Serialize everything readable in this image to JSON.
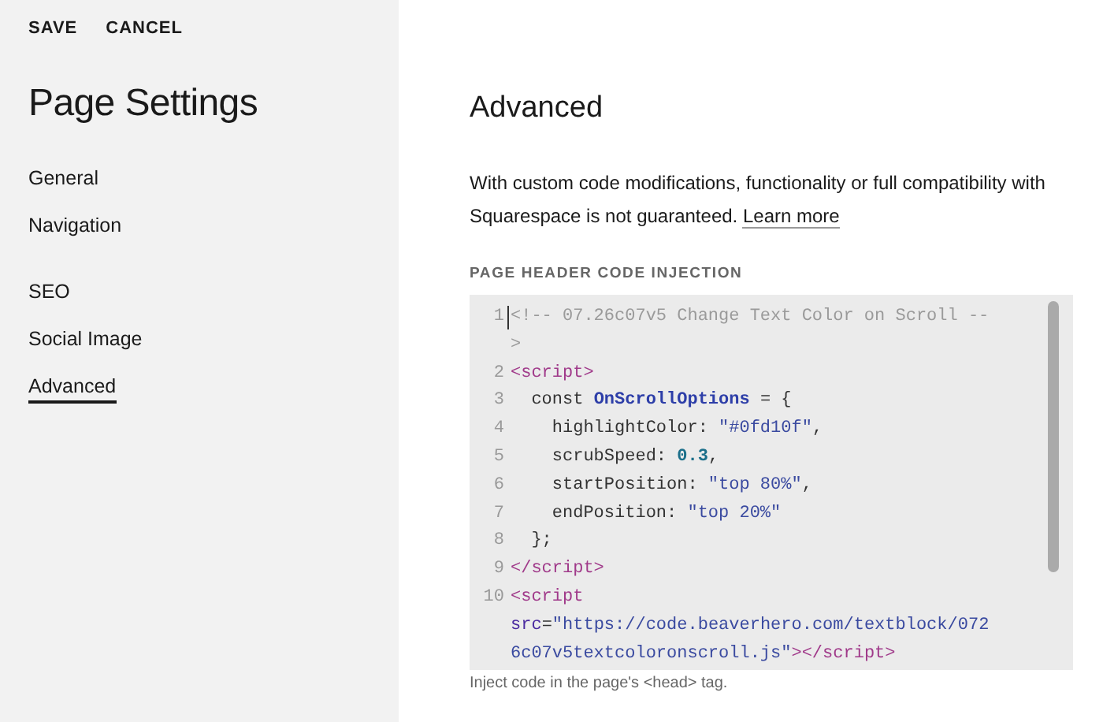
{
  "top_actions": [
    "SAVE",
    "CANCEL"
  ],
  "sidebar": {
    "title": "Page Settings",
    "groups": [
      [
        {
          "label": "General",
          "selected": false
        },
        {
          "label": "Navigation",
          "selected": false
        }
      ],
      [
        {
          "label": "SEO",
          "selected": false
        },
        {
          "label": "Social Image",
          "selected": false
        },
        {
          "label": "Advanced",
          "selected": true
        }
      ]
    ]
  },
  "main": {
    "heading": "Advanced",
    "notice": "With custom code modifications, functionality or full compatibility with Squarespace is not guaranteed.",
    "notice_link": "Learn more",
    "section_label": "PAGE HEADER CODE INJECTION",
    "code_lines": [
      {
        "number": "1",
        "rows": [
          {
            "tokens": [
              {
                "kind": "comment",
                "text": "<!-- 07.26c07v5 Change Text Color on Scroll --"
              }
            ]
          },
          {
            "tokens": [
              {
                "kind": "comment",
                "text": ">"
              }
            ]
          }
        ]
      },
      {
        "number": "2",
        "rows": [
          {
            "tokens": [
              {
                "kind": "tag",
                "text": "<script>"
              }
            ]
          }
        ]
      },
      {
        "number": "3",
        "rows": [
          {
            "tokens": [
              {
                "kind": "plain",
                "text": "  const "
              },
              {
                "kind": "def",
                "text": "OnScrollOptions"
              },
              {
                "kind": "plain",
                "text": " = {"
              }
            ]
          }
        ]
      },
      {
        "number": "4",
        "rows": [
          {
            "tokens": [
              {
                "kind": "plain",
                "text": "    highlightColor: "
              },
              {
                "kind": "string",
                "text": "\"#0fd10f\""
              },
              {
                "kind": "plain",
                "text": ","
              }
            ]
          }
        ]
      },
      {
        "number": "5",
        "rows": [
          {
            "tokens": [
              {
                "kind": "plain",
                "text": "    scrubSpeed: "
              },
              {
                "kind": "number",
                "text": "0.3"
              },
              {
                "kind": "plain",
                "text": ","
              }
            ]
          }
        ]
      },
      {
        "number": "6",
        "rows": [
          {
            "tokens": [
              {
                "kind": "plain",
                "text": "    startPosition: "
              },
              {
                "kind": "string",
                "text": "\"top 80%\""
              },
              {
                "kind": "plain",
                "text": ","
              }
            ]
          }
        ]
      },
      {
        "number": "7",
        "rows": [
          {
            "tokens": [
              {
                "kind": "plain",
                "text": "    endPosition: "
              },
              {
                "kind": "string",
                "text": "\"top 20%\""
              }
            ]
          }
        ]
      },
      {
        "number": "8",
        "rows": [
          {
            "tokens": [
              {
                "kind": "plain",
                "text": "  };"
              }
            ]
          }
        ]
      },
      {
        "number": "9",
        "rows": [
          {
            "tokens": [
              {
                "kind": "tag",
                "text": "</script>"
              }
            ]
          }
        ]
      },
      {
        "number": "10",
        "rows": [
          {
            "tokens": [
              {
                "kind": "tag",
                "text": "<script"
              }
            ]
          },
          {
            "tokens": [
              {
                "kind": "attr",
                "text": "src"
              },
              {
                "kind": "plain",
                "text": "="
              },
              {
                "kind": "string",
                "text": "\"https://code.beaverhero.com/textblock/072"
              }
            ]
          },
          {
            "tokens": [
              {
                "kind": "string",
                "text": "6c07v5textcoloronscroll.js\""
              },
              {
                "kind": "tag",
                "text": "></script>"
              }
            ]
          }
        ]
      }
    ],
    "hint": "Inject code in the page's <head> tag."
  }
}
